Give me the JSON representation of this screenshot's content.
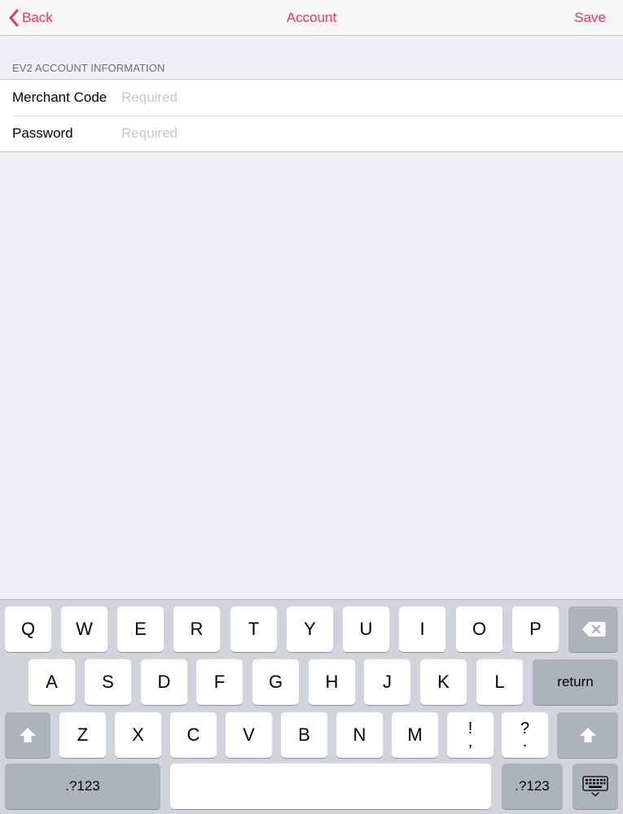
{
  "nav": {
    "back_label": "Back",
    "title": "Account",
    "save_label": "Save",
    "accent_color": "#e8336f"
  },
  "section": {
    "header": "EV2 ACCOUNT INFORMATION"
  },
  "form": {
    "merchant_code": {
      "label": "Merchant Code",
      "value": "",
      "placeholder": "Required"
    },
    "password": {
      "label": "Password",
      "value": "",
      "placeholder": "Required"
    }
  },
  "keyboard": {
    "row1": [
      "Q",
      "W",
      "E",
      "R",
      "T",
      "Y",
      "U",
      "I",
      "O",
      "P"
    ],
    "row2": [
      "A",
      "S",
      "D",
      "F",
      "G",
      "H",
      "J",
      "K",
      "L"
    ],
    "row3": [
      "Z",
      "X",
      "C",
      "V",
      "B",
      "N",
      "M"
    ],
    "exclaim_top": "!",
    "exclaim_bottom": ",",
    "question_top": "?",
    "question_bottom": ".",
    "return_label": "return",
    "numbers_label": ".?123",
    "icons": {
      "backspace": "backspace-icon",
      "shift": "shift-icon",
      "dismiss": "keyboard-dismiss-icon"
    }
  }
}
